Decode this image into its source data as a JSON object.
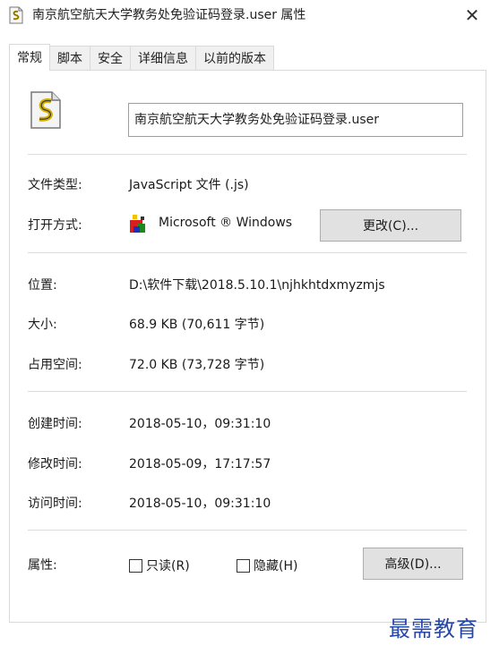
{
  "window": {
    "title": "南京航空航天大学教务处免验证码登录.user 属性",
    "close_label": "✕"
  },
  "tabs": [
    {
      "label": "常规",
      "active": true
    },
    {
      "label": "脚本",
      "active": false
    },
    {
      "label": "安全",
      "active": false
    },
    {
      "label": "详细信息",
      "active": false
    },
    {
      "label": "以前的版本",
      "active": false
    }
  ],
  "general": {
    "filename": "南京航空航天大学教务处免验证码登录.user",
    "file_type_label": "文件类型:",
    "file_type_value": "JavaScript 文件 (.js)",
    "open_with_label": "打开方式:",
    "open_with_value": "Microsoft ® Windows",
    "change_button": "更改(C)...",
    "location_label": "位置:",
    "location_value": "D:\\软件下载\\2018.5.10.1\\njhkhtdxmyzmjs",
    "size_label": "大小:",
    "size_value": "68.9 KB (70,611 字节)",
    "size_on_disk_label": "占用空间:",
    "size_on_disk_value": "72.0 KB (73,728 字节)",
    "created_label": "创建时间:",
    "created_value": "2018-05-10，09:31:10",
    "modified_label": "修改时间:",
    "modified_value": "2018-05-09，17:17:57",
    "accessed_label": "访问时间:",
    "accessed_value": "2018-05-10，09:31:10",
    "attributes_label": "属性:",
    "readonly_label": "只读(R)",
    "readonly_checked": false,
    "hidden_label": "隐藏(H)",
    "hidden_checked": false,
    "advanced_button": "高级(D)..."
  },
  "watermark": "最需教育",
  "icons": {
    "title_icon": "script-file-icon",
    "file_icon": "script-file-icon",
    "app_icon": "windows-script-host-icon"
  }
}
